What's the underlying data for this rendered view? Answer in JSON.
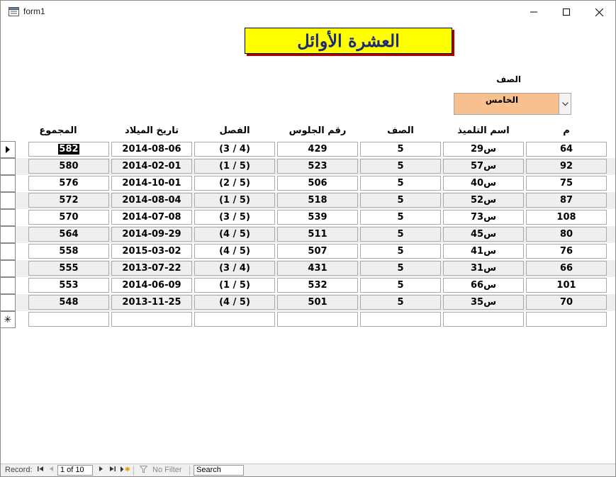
{
  "window": {
    "title": "form1",
    "minimize_label": "minimize",
    "maximize_label": "maximize",
    "close_label": "close"
  },
  "form": {
    "heading": "العشرة الأوائل",
    "class_label": "الصف",
    "class_value": "الخامس",
    "colors": {
      "heading_bg": "#ffff00",
      "heading_text": "#1f2a7a",
      "heading_shadow": "#b00000",
      "combo_bg": "#f8c08f"
    }
  },
  "table": {
    "headers": {
      "m": "م",
      "name": "اسم التلميذ",
      "class": "الصف",
      "seat": "رقم الجلوس",
      "section": "الفصل",
      "birth": "تاريخ الميلاد",
      "total": "المجموع"
    },
    "rows": [
      {
        "m": "64",
        "name": "س29",
        "class": "5",
        "seat": "429",
        "section": "(3 / 4)",
        "birth": "2014-08-06",
        "total": "582"
      },
      {
        "m": "92",
        "name": "س57",
        "class": "5",
        "seat": "523",
        "section": "(1 / 5)",
        "birth": "2014-02-01",
        "total": "580"
      },
      {
        "m": "75",
        "name": "س40",
        "class": "5",
        "seat": "506",
        "section": "(2 / 5)",
        "birth": "2014-10-01",
        "total": "576"
      },
      {
        "m": "87",
        "name": "س52",
        "class": "5",
        "seat": "518",
        "section": "(1 / 5)",
        "birth": "2014-08-04",
        "total": "572"
      },
      {
        "m": "108",
        "name": "س73",
        "class": "5",
        "seat": "539",
        "section": "(3 / 5)",
        "birth": "2014-07-08",
        "total": "570"
      },
      {
        "m": "80",
        "name": "س45",
        "class": "5",
        "seat": "511",
        "section": "(4 / 5)",
        "birth": "2014-09-29",
        "total": "564"
      },
      {
        "m": "76",
        "name": "س41",
        "class": "5",
        "seat": "507",
        "section": "(4 / 5)",
        "birth": "2015-03-02",
        "total": "558"
      },
      {
        "m": "66",
        "name": "س31",
        "class": "5",
        "seat": "431",
        "section": "(3 / 4)",
        "birth": "2013-07-22",
        "total": "555"
      },
      {
        "m": "101",
        "name": "س66",
        "class": "5",
        "seat": "532",
        "section": "(1 / 5)",
        "birth": "2014-06-09",
        "total": "553"
      },
      {
        "m": "70",
        "name": "س35",
        "class": "5",
        "seat": "501",
        "section": "(4 / 5)",
        "birth": "2013-11-25",
        "total": "548"
      }
    ],
    "current_row_icon": "current-record-arrow-icon",
    "new_row_icon": "new-record-asterisk-icon"
  },
  "statusbar": {
    "record_label": "Record:",
    "record_position": "1 of 10",
    "no_filter_label": "No Filter",
    "search_placeholder": "Search"
  }
}
